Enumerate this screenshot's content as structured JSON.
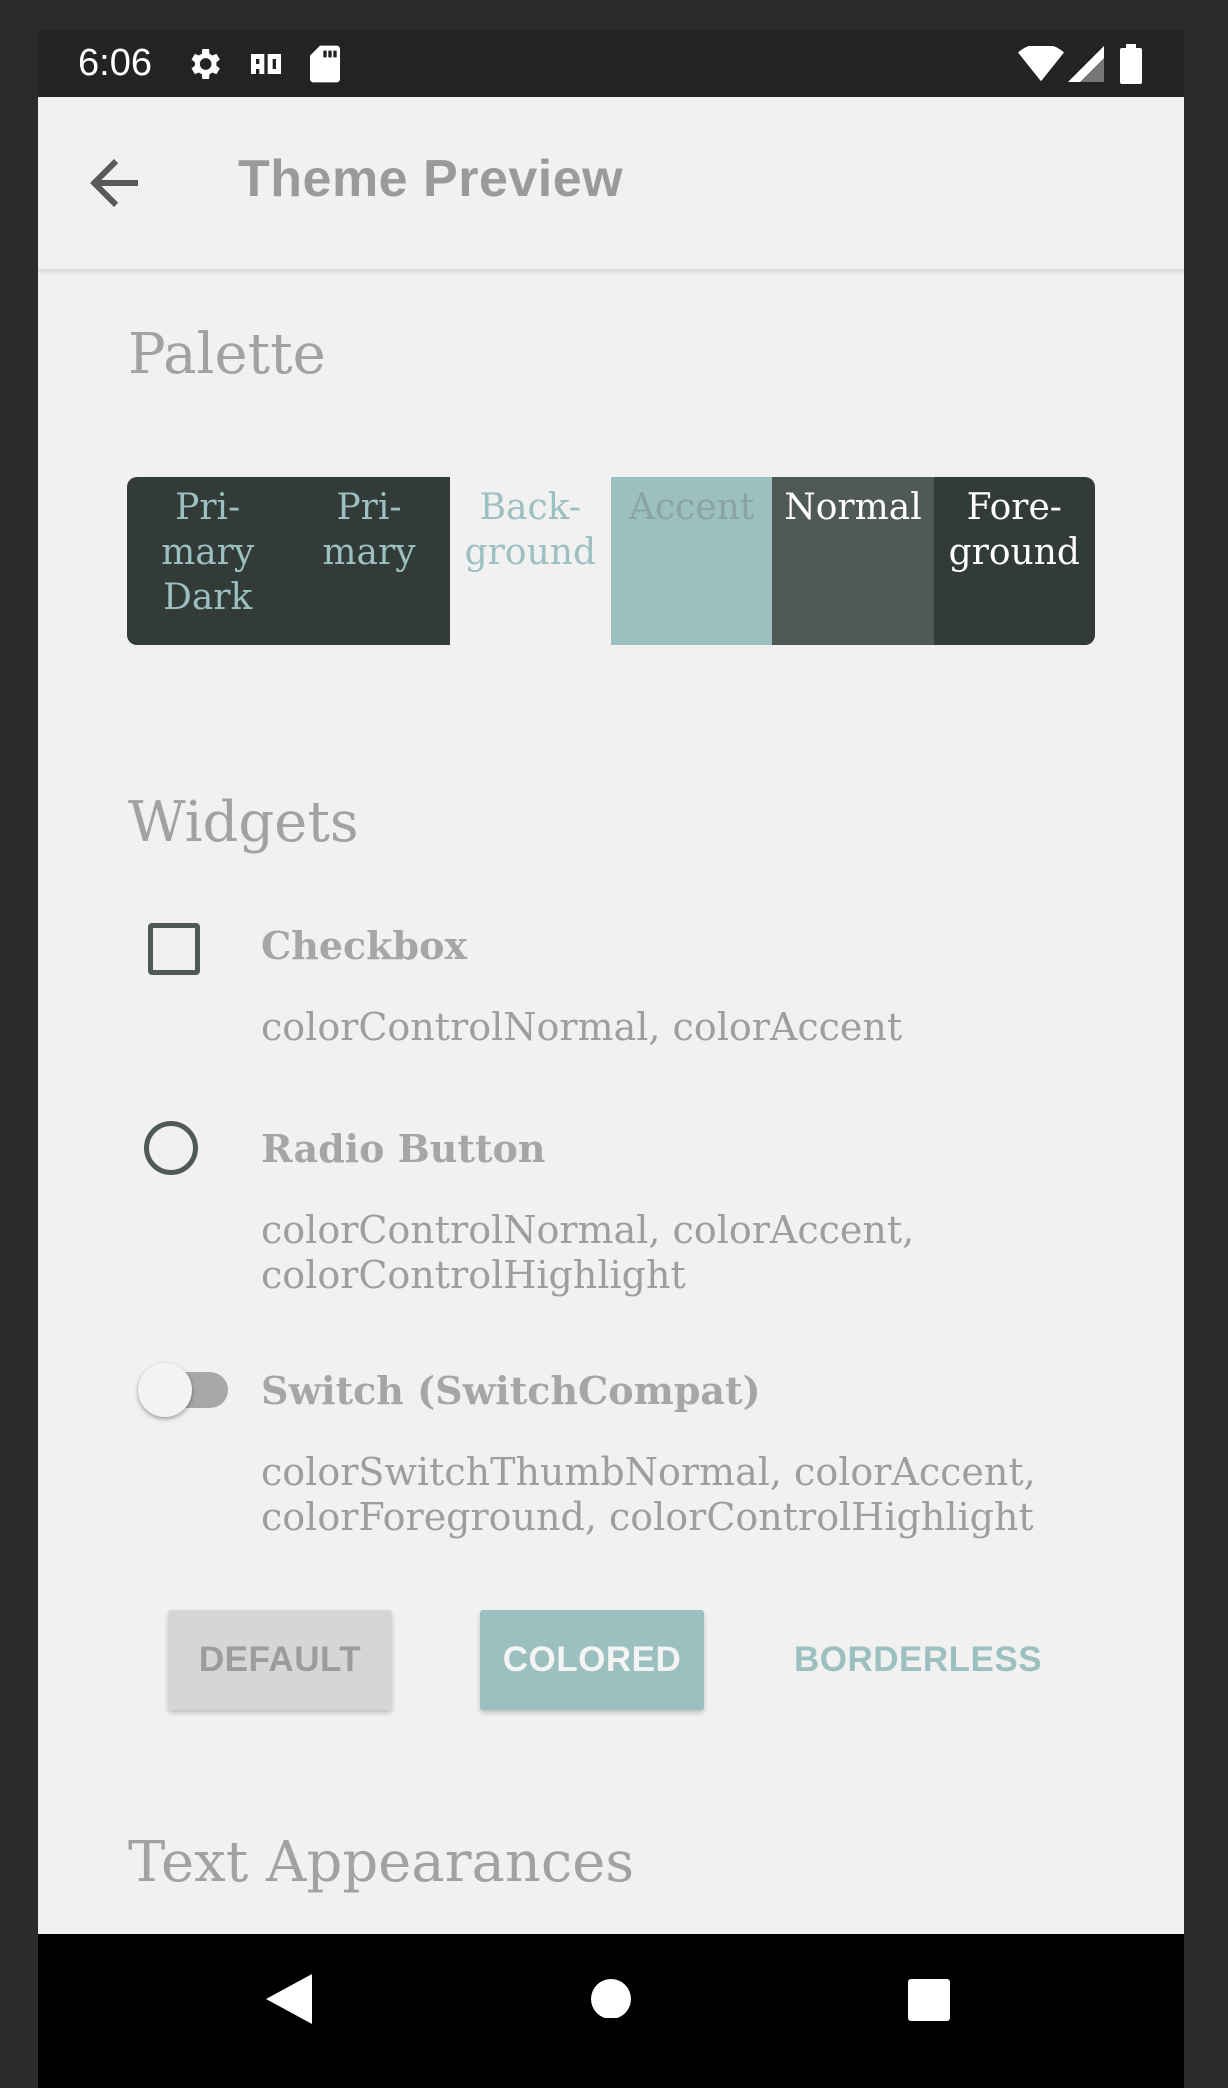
{
  "status_bar": {
    "time": "6:06",
    "icons": [
      "gear-icon",
      "assistant-icon",
      "sd-card-icon",
      "wifi-icon",
      "signal-icon",
      "battery-icon"
    ]
  },
  "app_bar": {
    "title": "Theme Preview",
    "back_icon": "arrow-back-icon"
  },
  "palette": {
    "title": "Palette",
    "swatches": [
      {
        "label": "Pri-\nmary\nDark",
        "bg": "#323b38",
        "fg": "#9cbfc0"
      },
      {
        "label": "Pri-\nmary",
        "bg": "#323b38",
        "fg": "#9cbfc0"
      },
      {
        "label": "Back-\nground",
        "bg": "#f1f1f1",
        "fg": "#9cbfc0"
      },
      {
        "label": "Accent",
        "bg": "#9cbfc0",
        "fg": "#8aa3a3"
      },
      {
        "label": "Normal",
        "bg": "#4f5a57",
        "fg": "#ffffff"
      },
      {
        "label": "Fore-\nground",
        "bg": "#323b38",
        "fg": "#ffffff"
      }
    ]
  },
  "widgets": {
    "title": "Widgets",
    "checkbox": {
      "label": "Checkbox",
      "desc": "colorControlNormal, colorAccent",
      "checked": false
    },
    "radio": {
      "label": "Radio Button",
      "desc": "colorControlNormal, colorAccent, colorControlHighlight",
      "selected": false
    },
    "switch": {
      "label": "Switch (SwitchCompat)",
      "desc": "colorSwitchThumbNormal, colorAccent, colorForeground, colorControlHighlight",
      "on": false
    },
    "buttons": {
      "default": "DEFAULT",
      "colored": "COLORED",
      "borderless": "BORDERLESS"
    }
  },
  "text_appearances": {
    "title": "Text Appearances"
  },
  "colors": {
    "accent": "#9cbfc0",
    "primary": "#323b38",
    "normal": "#4f5a57",
    "background": "#f1f1f1"
  },
  "nav_bar": {
    "icons": [
      "back-triangle-icon",
      "home-circle-icon",
      "recents-square-icon"
    ]
  }
}
